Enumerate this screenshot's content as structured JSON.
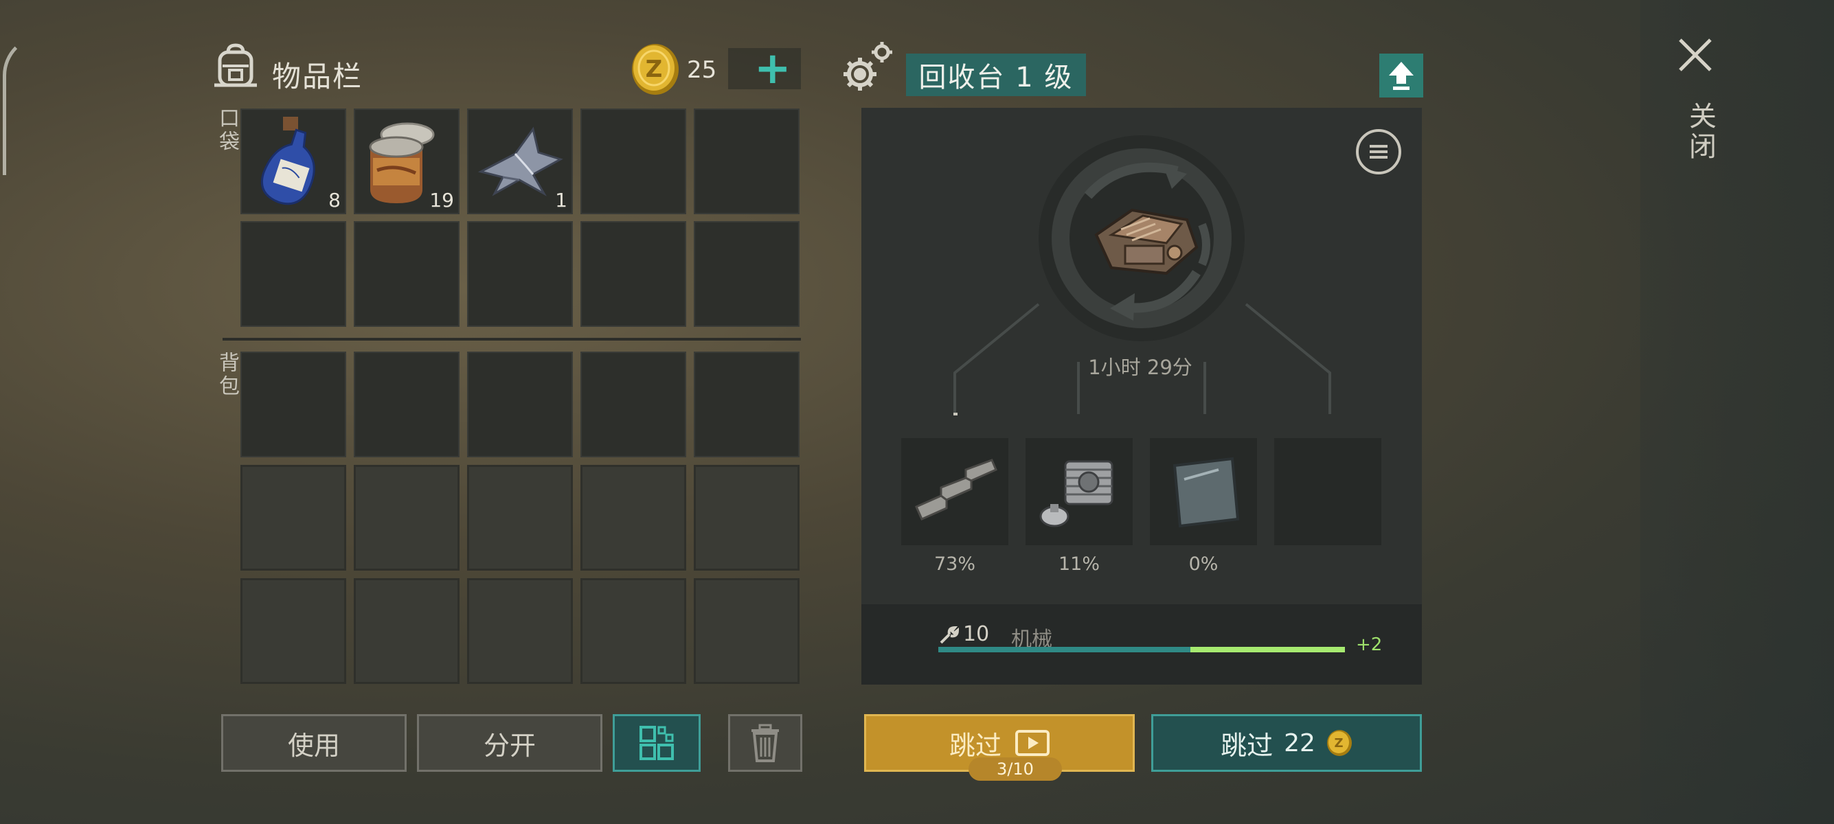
{
  "inventory": {
    "title": "物品栏",
    "coins": "25",
    "add_icon": "+",
    "pocket_label": "口袋",
    "backpack_label": "背包",
    "items": [
      {
        "name": "water-bottle",
        "qty": "8"
      },
      {
        "name": "canned-food",
        "qty": "19"
      },
      {
        "name": "metal-scraps",
        "qty": "1"
      }
    ],
    "buttons": {
      "use": "使用",
      "split": "分开"
    }
  },
  "recycler": {
    "title": "回收台 1 级",
    "timer": "1小时 29分",
    "outputs": [
      {
        "name": "metal-bars",
        "pct": "73%"
      },
      {
        "name": "engine-parts",
        "pct": "11%"
      },
      {
        "name": "glass-plate",
        "pct": "0%"
      },
      {
        "name": "empty",
        "pct": ""
      }
    ],
    "skill": {
      "level": "10",
      "name": "机械",
      "gain": "+2",
      "progress": 0.62,
      "gain_progress": 0.38
    },
    "skip_ad": {
      "label": "跳过",
      "counter": "3/10"
    },
    "skip_coins": {
      "label": "跳过",
      "cost": "22"
    }
  },
  "close_label": "关闭",
  "colors": {
    "accent_teal": "#3fbfae",
    "gold": "#c3922a",
    "skill_green": "#9ee06b"
  },
  "icons": [
    "backpack-icon",
    "coin-icon",
    "plus-icon",
    "gear-icon",
    "arrow-up-icon",
    "menu-icon",
    "recycle-icon",
    "wrench-icon",
    "play-icon",
    "trash-icon",
    "grid-icon",
    "close-icon"
  ]
}
